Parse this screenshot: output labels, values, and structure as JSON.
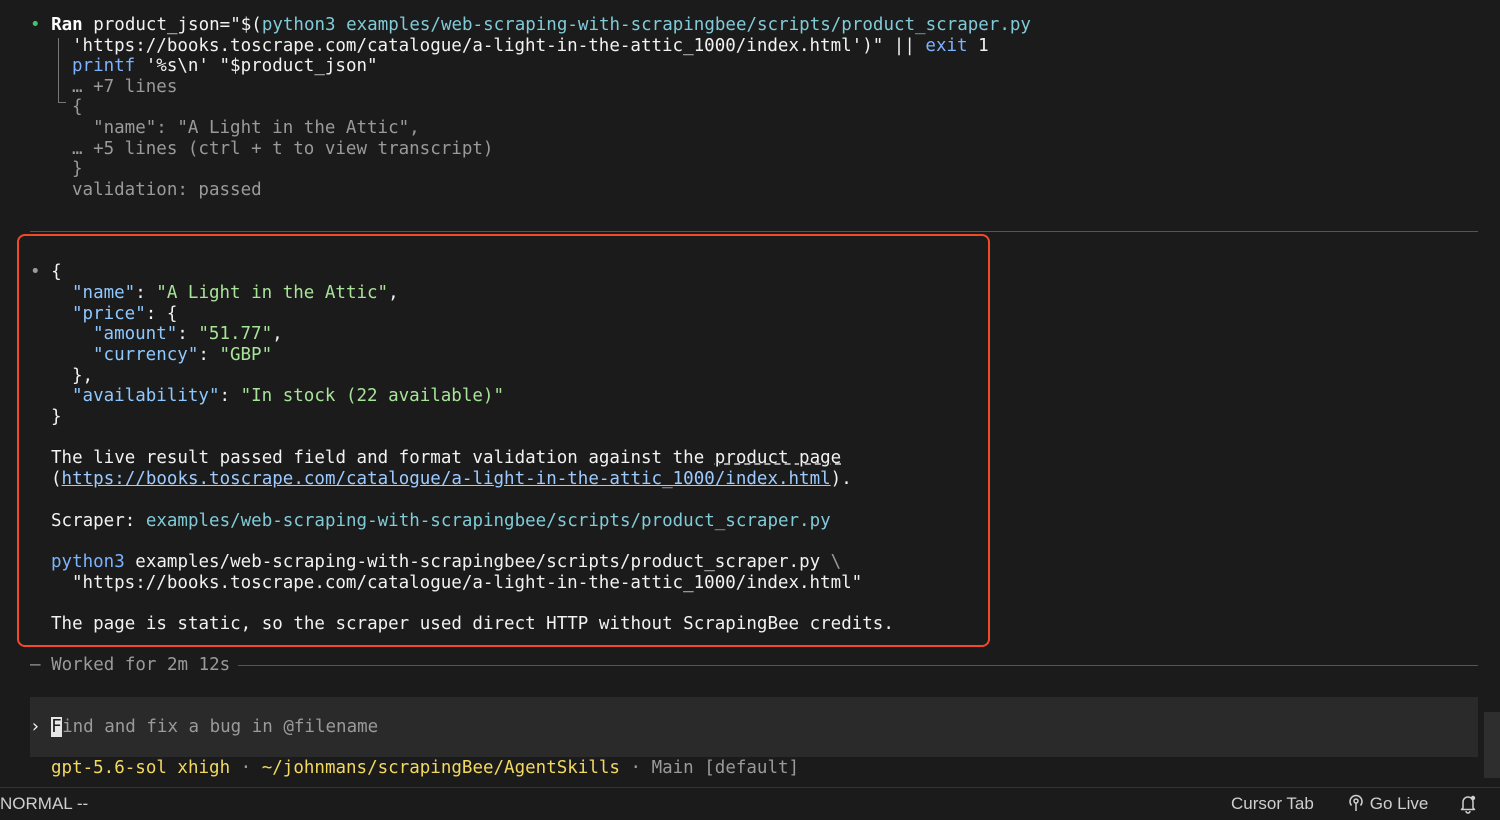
{
  "ran": {
    "bullet": "•",
    "label": "Ran",
    "cmd_line1_a": " product_json=\"$(",
    "cmd_line1_b": "python3 examples/web-scraping-with-scrapingbee/scripts/product_scraper.py",
    "cmd_line2_str": "'https://books.toscrape.com/catalogue/a-light-in-the-attic_1000/index.html'",
    "cmd_line2_mid": ")\" || ",
    "cmd_line2_exit": "exit",
    "cmd_line2_code": " 1",
    "cmd_line3_printf": "printf",
    "cmd_line3_fmt": " '%s\\n' ",
    "cmd_line3_var": "\"$product_json\"",
    "out_1": "… +7 lines",
    "out_2": "{",
    "out_3": "  \"name\": \"A Light in the Attic\",",
    "out_4": "… +5 lines (ctrl + t to view transcript)",
    "out_5": "}",
    "out_6": "validation: passed"
  },
  "answer": {
    "bullet": "•",
    "json_open": "{",
    "name_key": "\"name\"",
    "name_val": "\"A Light in the Attic\"",
    "price_key": "\"price\"",
    "amount_key": "\"amount\"",
    "amount_val": "\"51.77\"",
    "currency_key": "\"currency\"",
    "currency_val": "\"GBP\"",
    "price_close": "},",
    "avail_key": "\"availability\"",
    "avail_val": "\"In stock (22 available)\"",
    "json_close": "}",
    "para1_a": "The live result passed field and format validation against the ",
    "para1_link_text": "product page",
    "para1_url": "https://books.toscrape.com/catalogue/a-light-in-the-attic_1000/index.html",
    "scraper_label": "Scraper: ",
    "scraper_path": "examples/web-scraping-with-scrapingbee/scripts/product_scraper.py",
    "run_python": "python3",
    "run_script": " examples/web-scraping-with-scrapingbee/scripts/product_scraper.py ",
    "run_backslash": "\\",
    "run_url": "\"https://books.toscrape.com/catalogue/a-light-in-the-attic_1000/index.html\"",
    "final": "The page is static, so the scraper used direct HTTP without ScrapingBee credits."
  },
  "worked": "— Worked for 2m 12s",
  "composer": {
    "prompt_char": "›",
    "placeholder_first": "F",
    "placeholder_rest": "ind and fix a bug in @filename"
  },
  "footer_info": {
    "model": "gpt-5.6-sol xhigh",
    "sep": " · ",
    "path": "~/johnmans/scrapingBee/AgentSkills",
    "branch": "Main [default]"
  },
  "statusbar": {
    "mode": "NORMAL --",
    "cursor_tab": "Cursor Tab",
    "go_live": "Go Live"
  },
  "colors": {
    "highlight_border": "#f04a2a",
    "bullet_green": "#3ec46d"
  }
}
